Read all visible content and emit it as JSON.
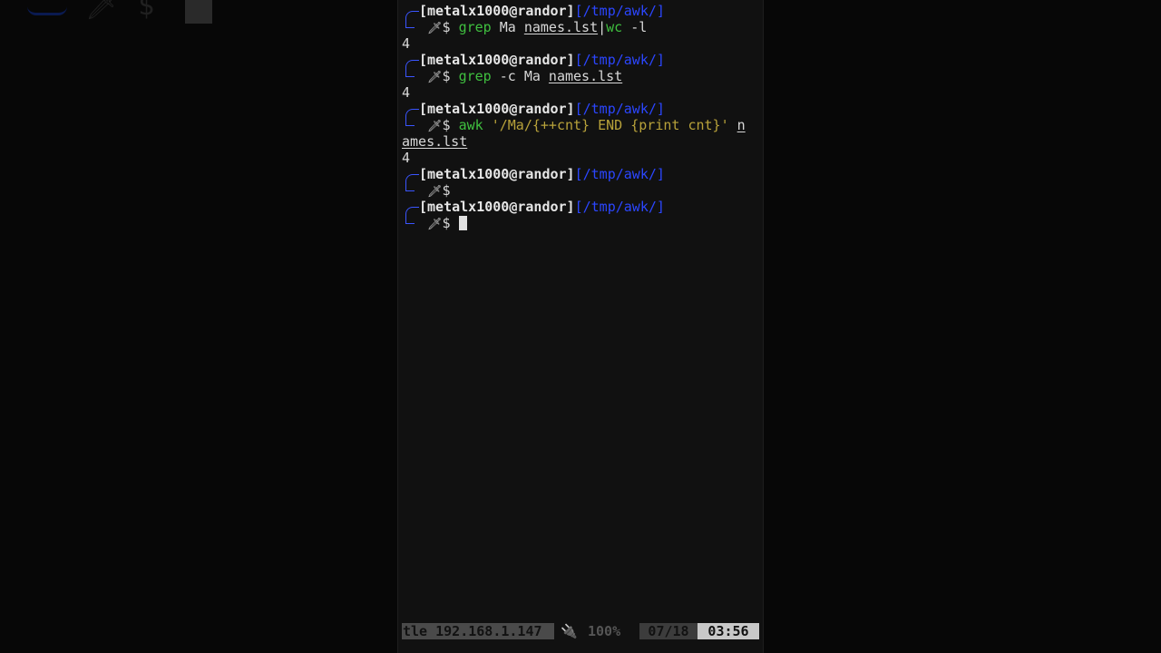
{
  "background": {
    "glyphs": [
      "🗡",
      "$"
    ]
  },
  "terminal": {
    "blocks": [
      {
        "user": "[metalx1000@randor]",
        "path": "[/tmp/awk/]",
        "sym": "🗡",
        "dollar": "$ ",
        "cmd": [
          {
            "t": "grep",
            "c": "green"
          },
          {
            "t": " Ma ",
            "c": "plain"
          },
          {
            "t": "names.lst",
            "c": "plain",
            "u": true
          },
          {
            "t": "|",
            "c": "plain"
          },
          {
            "t": "wc",
            "c": "green"
          },
          {
            "t": " -l",
            "c": "plain"
          }
        ],
        "output": [
          "4"
        ]
      },
      {
        "user": "[metalx1000@randor]",
        "path": "[/tmp/awk/]",
        "sym": "🗡",
        "dollar": "$ ",
        "cmd": [
          {
            "t": "grep",
            "c": "green"
          },
          {
            "t": " -c Ma ",
            "c": "plain"
          },
          {
            "t": "names.lst",
            "c": "plain",
            "u": true
          }
        ],
        "output": [
          "4"
        ]
      },
      {
        "user": "[metalx1000@randor]",
        "path": "[/tmp/awk/]",
        "sym": "🗡",
        "dollar": "$ ",
        "cmd": [
          {
            "t": "awk",
            "c": "green"
          },
          {
            "t": " '/Ma/{++cnt} END {print cnt}' ",
            "c": "yellow"
          },
          {
            "t": "n",
            "c": "plain",
            "u": true
          }
        ],
        "cmd_wrap": [
          {
            "t": "ames.lst",
            "c": "plain",
            "u": true
          }
        ],
        "output": [
          "4"
        ]
      },
      {
        "user": "[metalx1000@randor]",
        "path": "[/tmp/awk/]",
        "sym": "🗡",
        "dollar": "$",
        "cmd": [],
        "output": []
      },
      {
        "user": "[metalx1000@randor]",
        "path": "[/tmp/awk/]",
        "sym": "🗡",
        "dollar": "$ ",
        "cmd": [],
        "cursor": true,
        "output": []
      }
    ]
  },
  "status_bar": {
    "network": "tle 192.168.1.147",
    "plug_icon": "🔌",
    "battery": "100%",
    "date": "07/18",
    "time": "03:56"
  }
}
